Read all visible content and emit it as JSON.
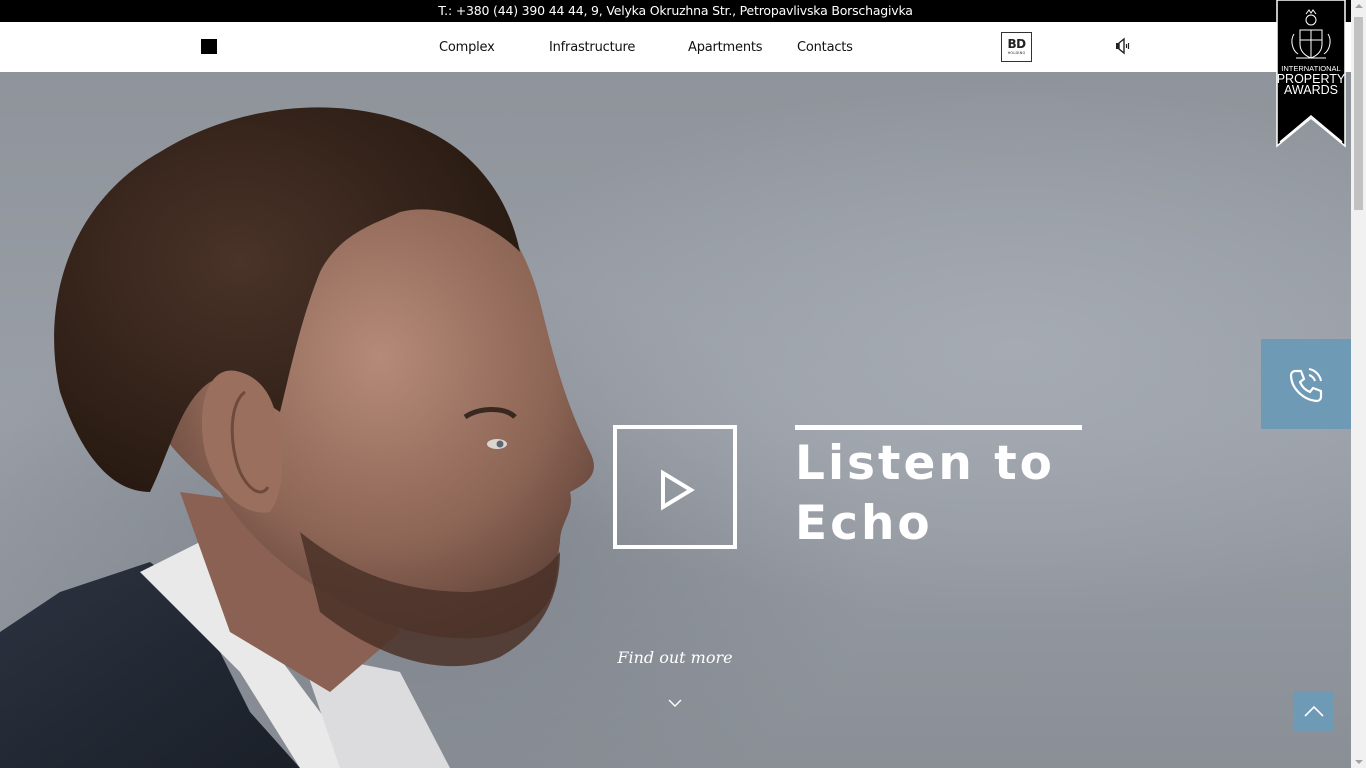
{
  "topbar": {
    "contact_line": "T.: +380 (44) 390 44 44, 9, Velyka Okruzhna Str., Petropavlivska Borschagivka"
  },
  "nav": {
    "items": [
      {
        "label": "Complex"
      },
      {
        "label": "Infrastructure"
      },
      {
        "label": "Apartments"
      },
      {
        "label": "Contacts"
      }
    ],
    "brand_logo": {
      "main": "BD",
      "sub": "HOLDING"
    },
    "sound_icon": "speaker-icon"
  },
  "hero": {
    "title_line1": "Listen to",
    "title_line2": "Echo",
    "play_icon": "play-icon",
    "find_more": "Find out more",
    "chevron_icon": "chevron-down-icon"
  },
  "award": {
    "line1": "INTERNATIONAL",
    "line2": "PROPERTY",
    "line3": "AWARDS",
    "crest_icon": "coat-of-arms-icon"
  },
  "call_button": {
    "icon": "phone-call-icon"
  },
  "scroll_top": {
    "icon": "chevron-up-icon"
  },
  "colors": {
    "accent": "#6e9ab5",
    "topbar_bg": "#000000",
    "nav_bg": "#ffffff",
    "hero_bg": "#8f949b"
  }
}
